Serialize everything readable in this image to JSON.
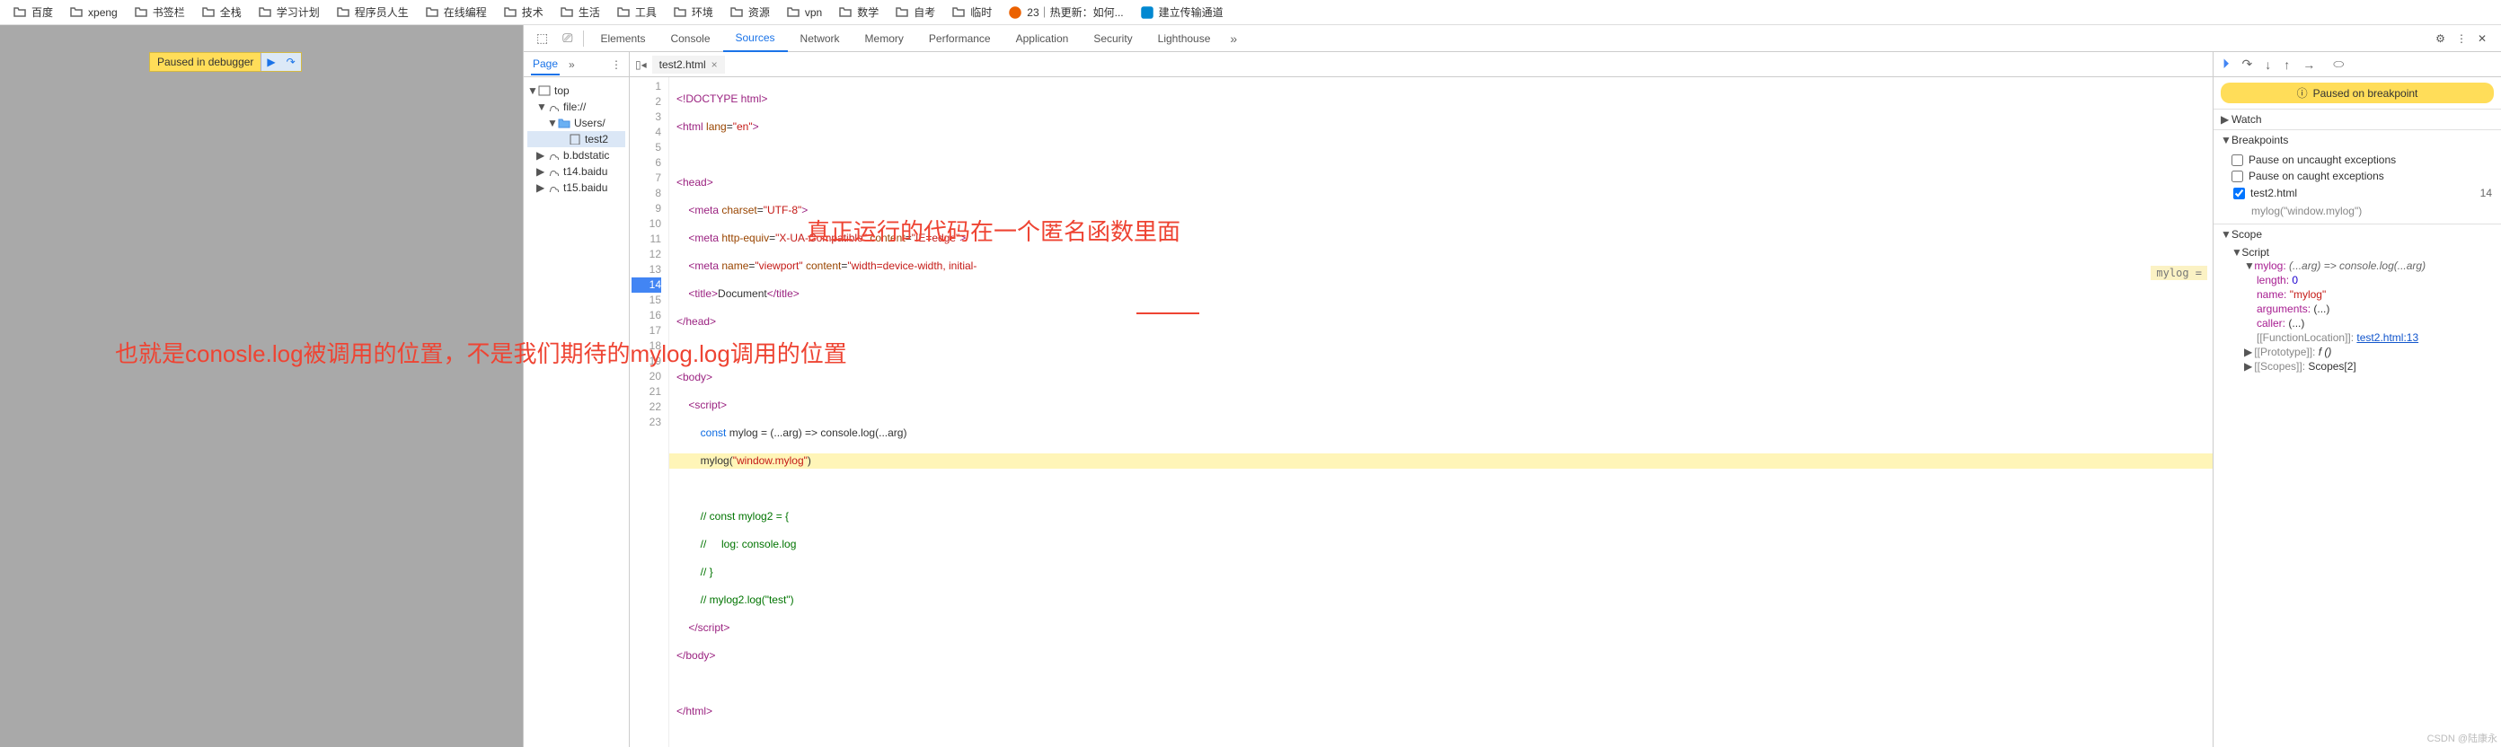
{
  "bookmarks": [
    "百度",
    "xpeng",
    "书签栏",
    "全栈",
    "学习计划",
    "程序员人生",
    "在线编程",
    "技术",
    "生活",
    "工具",
    "环境",
    "资源",
    "vpn",
    "数学",
    "自考",
    "临时"
  ],
  "bm_special1": "23｜热更新：如何...",
  "bm_special2": "建立传输通道",
  "paused": {
    "label": "Paused in debugger"
  },
  "devtools": {
    "tabs": [
      "Elements",
      "Console",
      "Sources",
      "Network",
      "Memory",
      "Performance",
      "Application",
      "Security",
      "Lighthouse"
    ],
    "active": "Sources"
  },
  "nav": {
    "sub": "Page",
    "tree": {
      "top": "top",
      "file": "file://",
      "users": "Users/",
      "test2": "test2",
      "bd": "b.bdstatic",
      "t14": "t14.baidu",
      "t15": "t15.baidu"
    }
  },
  "editor": {
    "tab": "test2.html",
    "lines": [
      "1",
      "2",
      "3",
      "4",
      "5",
      "6",
      "7",
      "8",
      "9",
      "10",
      "11",
      "12",
      "13",
      "14",
      "15",
      "16",
      "17",
      "18",
      "19",
      "20",
      "21",
      "22",
      "23"
    ],
    "hint": "mylog ="
  },
  "rp": {
    "pob": "Paused on breakpoint",
    "watch": "Watch",
    "bps": "Breakpoints",
    "cb1": "Pause on uncaught exceptions",
    "cb2": "Pause on caught exceptions",
    "bpfile": "test2.html",
    "bpcode": "mylog(\"window.mylog\")",
    "bpnum": "14",
    "scope": "Scope",
    "script": "Script",
    "mylog": "mylog:",
    "mylogv": "(...arg) => console.log(...arg)",
    "length": "length:",
    "lengthv": "0",
    "name": "name:",
    "namev": "\"mylog\"",
    "args": "arguments:",
    "argsv": "(...)",
    "caller": "caller:",
    "callerv": "(...)",
    "funcloc": "[[FunctionLocation]]:",
    "funclocv": "test2.html:13",
    "proto": "[[Prototype]]:",
    "protov": "f ()",
    "scopes": "[[Scopes]]:",
    "scopesv": "Scopes[2]"
  },
  "ann1": "真正运行的代码在一个匿名函数里面",
  "ann2": "也就是conosle.log被调用的位置，不是我们期待的mylog.log调用的位置",
  "wm": "CSDN @陆康永"
}
